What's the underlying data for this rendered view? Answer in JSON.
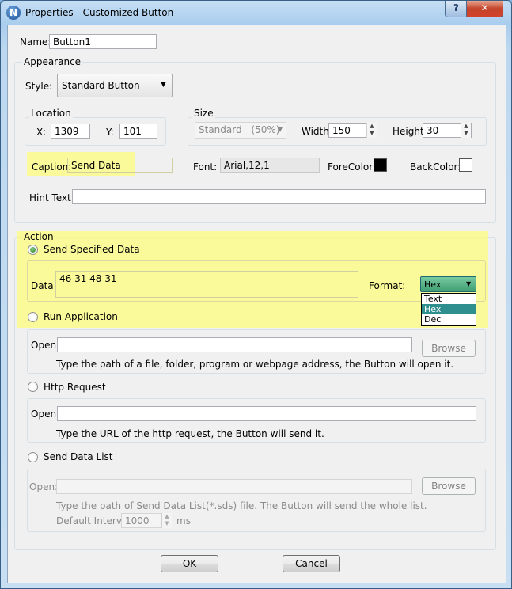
{
  "window": {
    "title": "Properties - Customized Button",
    "icon_letter": "N",
    "help_glyph": "?",
    "close_glyph": "✕"
  },
  "name": {
    "label": "Name:",
    "value": "Button1"
  },
  "appearance": {
    "group_label": "Appearance",
    "style_label": "Style:",
    "style_value": "Standard Button",
    "location_label": "Location",
    "x_label": "X:",
    "x_value": "1309",
    "y_label": "Y:",
    "y_value": "101",
    "size_label": "Size",
    "size_value": "Standard",
    "size_pct": "(50%)",
    "width_label": "Width:",
    "width_value": "150",
    "height_label": "Height:",
    "height_value": "30",
    "caption_label": "Caption:",
    "caption_value": "Send Data",
    "font_label": "Font:",
    "font_value": "Arial,12,1",
    "forecolor_label": "ForeColor:",
    "forecolor": "#000000",
    "backcolor_label": "BackColor:",
    "backcolor": "#ffffff",
    "hint_label": "Hint Text:",
    "hint_value": ""
  },
  "action": {
    "group_label": "Action",
    "send_specified": {
      "label": "Send Specified Data",
      "checked": true,
      "data_label": "Data:",
      "data_value": "46 31 48 31",
      "format_label": "Format:",
      "format_value": "Hex",
      "format_options": [
        "Text",
        "Hex",
        "Dec"
      ],
      "selected_option": "Hex"
    },
    "run_app": {
      "label": "Run Application",
      "open_label": "Open:",
      "open_value": "",
      "browse_label": "Browse",
      "hint": "Type the path of a file, folder, program or webpage address, the Button will open it."
    },
    "http": {
      "label": "Http Request",
      "open_label": "Open:",
      "open_value": "",
      "hint": "Type the URL of the http request, the Button will send it."
    },
    "send_list": {
      "label": "Send Data List",
      "open_label": "Open:",
      "open_value": "",
      "browse_label": "Browse",
      "hint": "Type the path of Send Data List(*.sds) file. The Button will send the whole list.",
      "interval_label": "Default Interval",
      "interval_value": "1000",
      "interval_unit": "ms"
    }
  },
  "footer": {
    "ok_label": "OK",
    "cancel_label": "Cancel"
  },
  "highlight_color": "#fdfd7f"
}
